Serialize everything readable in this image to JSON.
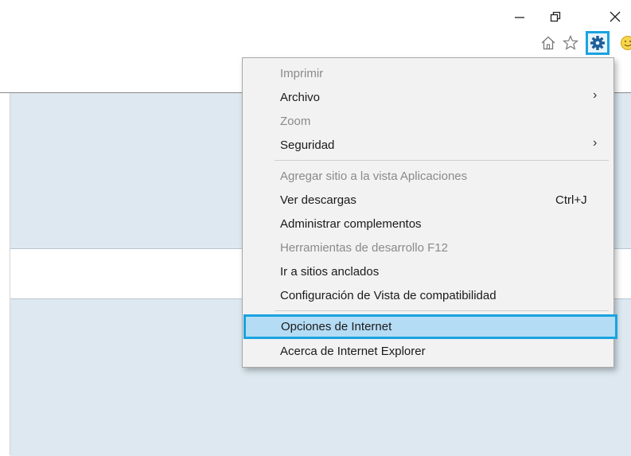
{
  "window_controls": {
    "minimize_glyph": "—",
    "restore_glyph": "❐",
    "close_glyph": "✕"
  },
  "toolbar": {
    "home_icon": "home-icon",
    "favorites_icon": "star-icon",
    "tools_icon": "gear-icon",
    "feedback_icon": "smiley-icon",
    "highlight_color": "#19a3e0"
  },
  "menu": {
    "items": [
      {
        "label": "Imprimir",
        "enabled": false
      },
      {
        "label": "Archivo",
        "enabled": true,
        "submenu_arrow": "›"
      },
      {
        "label": "Zoom",
        "enabled": false
      },
      {
        "label": "Seguridad",
        "enabled": true,
        "submenu_arrow": "›"
      },
      {
        "label": "Agregar sitio a la vista Aplicaciones",
        "enabled": false
      },
      {
        "label": "Ver descargas",
        "enabled": true,
        "shortcut": "Ctrl+J"
      },
      {
        "label": "Administrar complementos",
        "enabled": true
      },
      {
        "label": "Herramientas de desarrollo F12",
        "enabled": false
      },
      {
        "label": "Ir a sitios anclados",
        "enabled": true
      },
      {
        "label": "Configuración de Vista de compatibilidad",
        "enabled": true
      },
      {
        "label": "Opciones de Internet",
        "enabled": true,
        "highlighted": true
      },
      {
        "label": "Acerca de Internet Explorer",
        "enabled": true
      }
    ]
  }
}
